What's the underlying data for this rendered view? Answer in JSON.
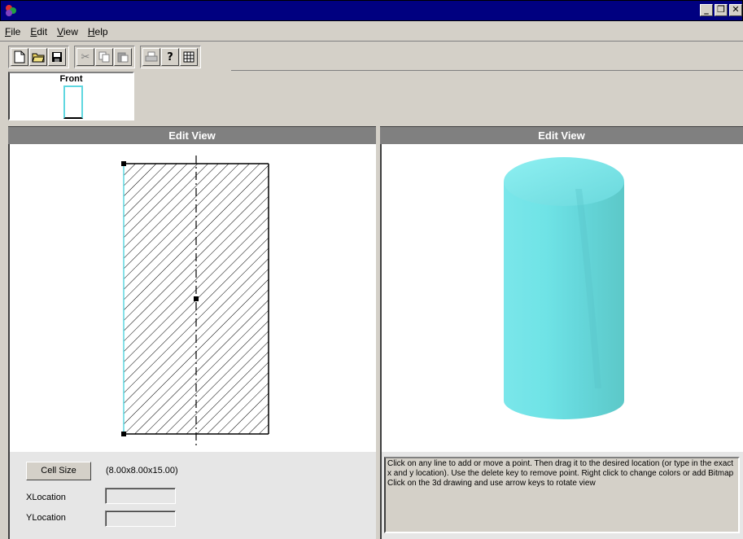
{
  "window": {
    "title": ""
  },
  "window_controls": [
    "minimize",
    "restore",
    "close"
  ],
  "menu": [
    {
      "underline": "F",
      "rest": "ile"
    },
    {
      "underline": "E",
      "rest": "dit"
    },
    {
      "underline": "V",
      "rest": "iew"
    },
    {
      "underline": "H",
      "rest": "elp"
    }
  ],
  "toolbar": {
    "groups": [
      [
        {
          "icon": "new-file-icon",
          "glyph": "🗋",
          "enabled": true
        },
        {
          "icon": "open-folder-icon",
          "glyph": "📂",
          "enabled": true
        },
        {
          "icon": "save-icon",
          "glyph": "💾",
          "enabled": true
        }
      ],
      [
        {
          "icon": "cut-icon",
          "glyph": "✂",
          "enabled": false
        },
        {
          "icon": "copy-icon",
          "glyph": "⎘",
          "enabled": false
        },
        {
          "icon": "paste-icon",
          "glyph": "📋",
          "enabled": false
        }
      ],
      [
        {
          "icon": "print-icon",
          "glyph": "⎙",
          "enabled": false
        },
        {
          "icon": "help-icon",
          "glyph": "?",
          "enabled": true
        },
        {
          "icon": "grid-icon",
          "glyph": "▦",
          "enabled": true
        }
      ]
    ]
  },
  "thumbnail": {
    "label": "Front"
  },
  "left_panel": {
    "header": "Edit View"
  },
  "right_panel": {
    "header": "Edit View"
  },
  "cell_size": {
    "button_label": "Cell Size",
    "value": "(8.00x8.00x15.00)"
  },
  "xlocation": {
    "label": "XLocation",
    "value": ""
  },
  "ylocation": {
    "label": "YLocation",
    "value": ""
  },
  "help_text": "Click on any line to add or move a point. Then drag it to the desired location (or type in the exact x and y location). Use the delete key to remove point. Right click to change colors or add Bitmap Click on the 3d drawing and use arrow keys to rotate view",
  "colors": {
    "title_bar": "#000080",
    "cylinder": "#6fe0e0",
    "panel_header": "#808080"
  }
}
